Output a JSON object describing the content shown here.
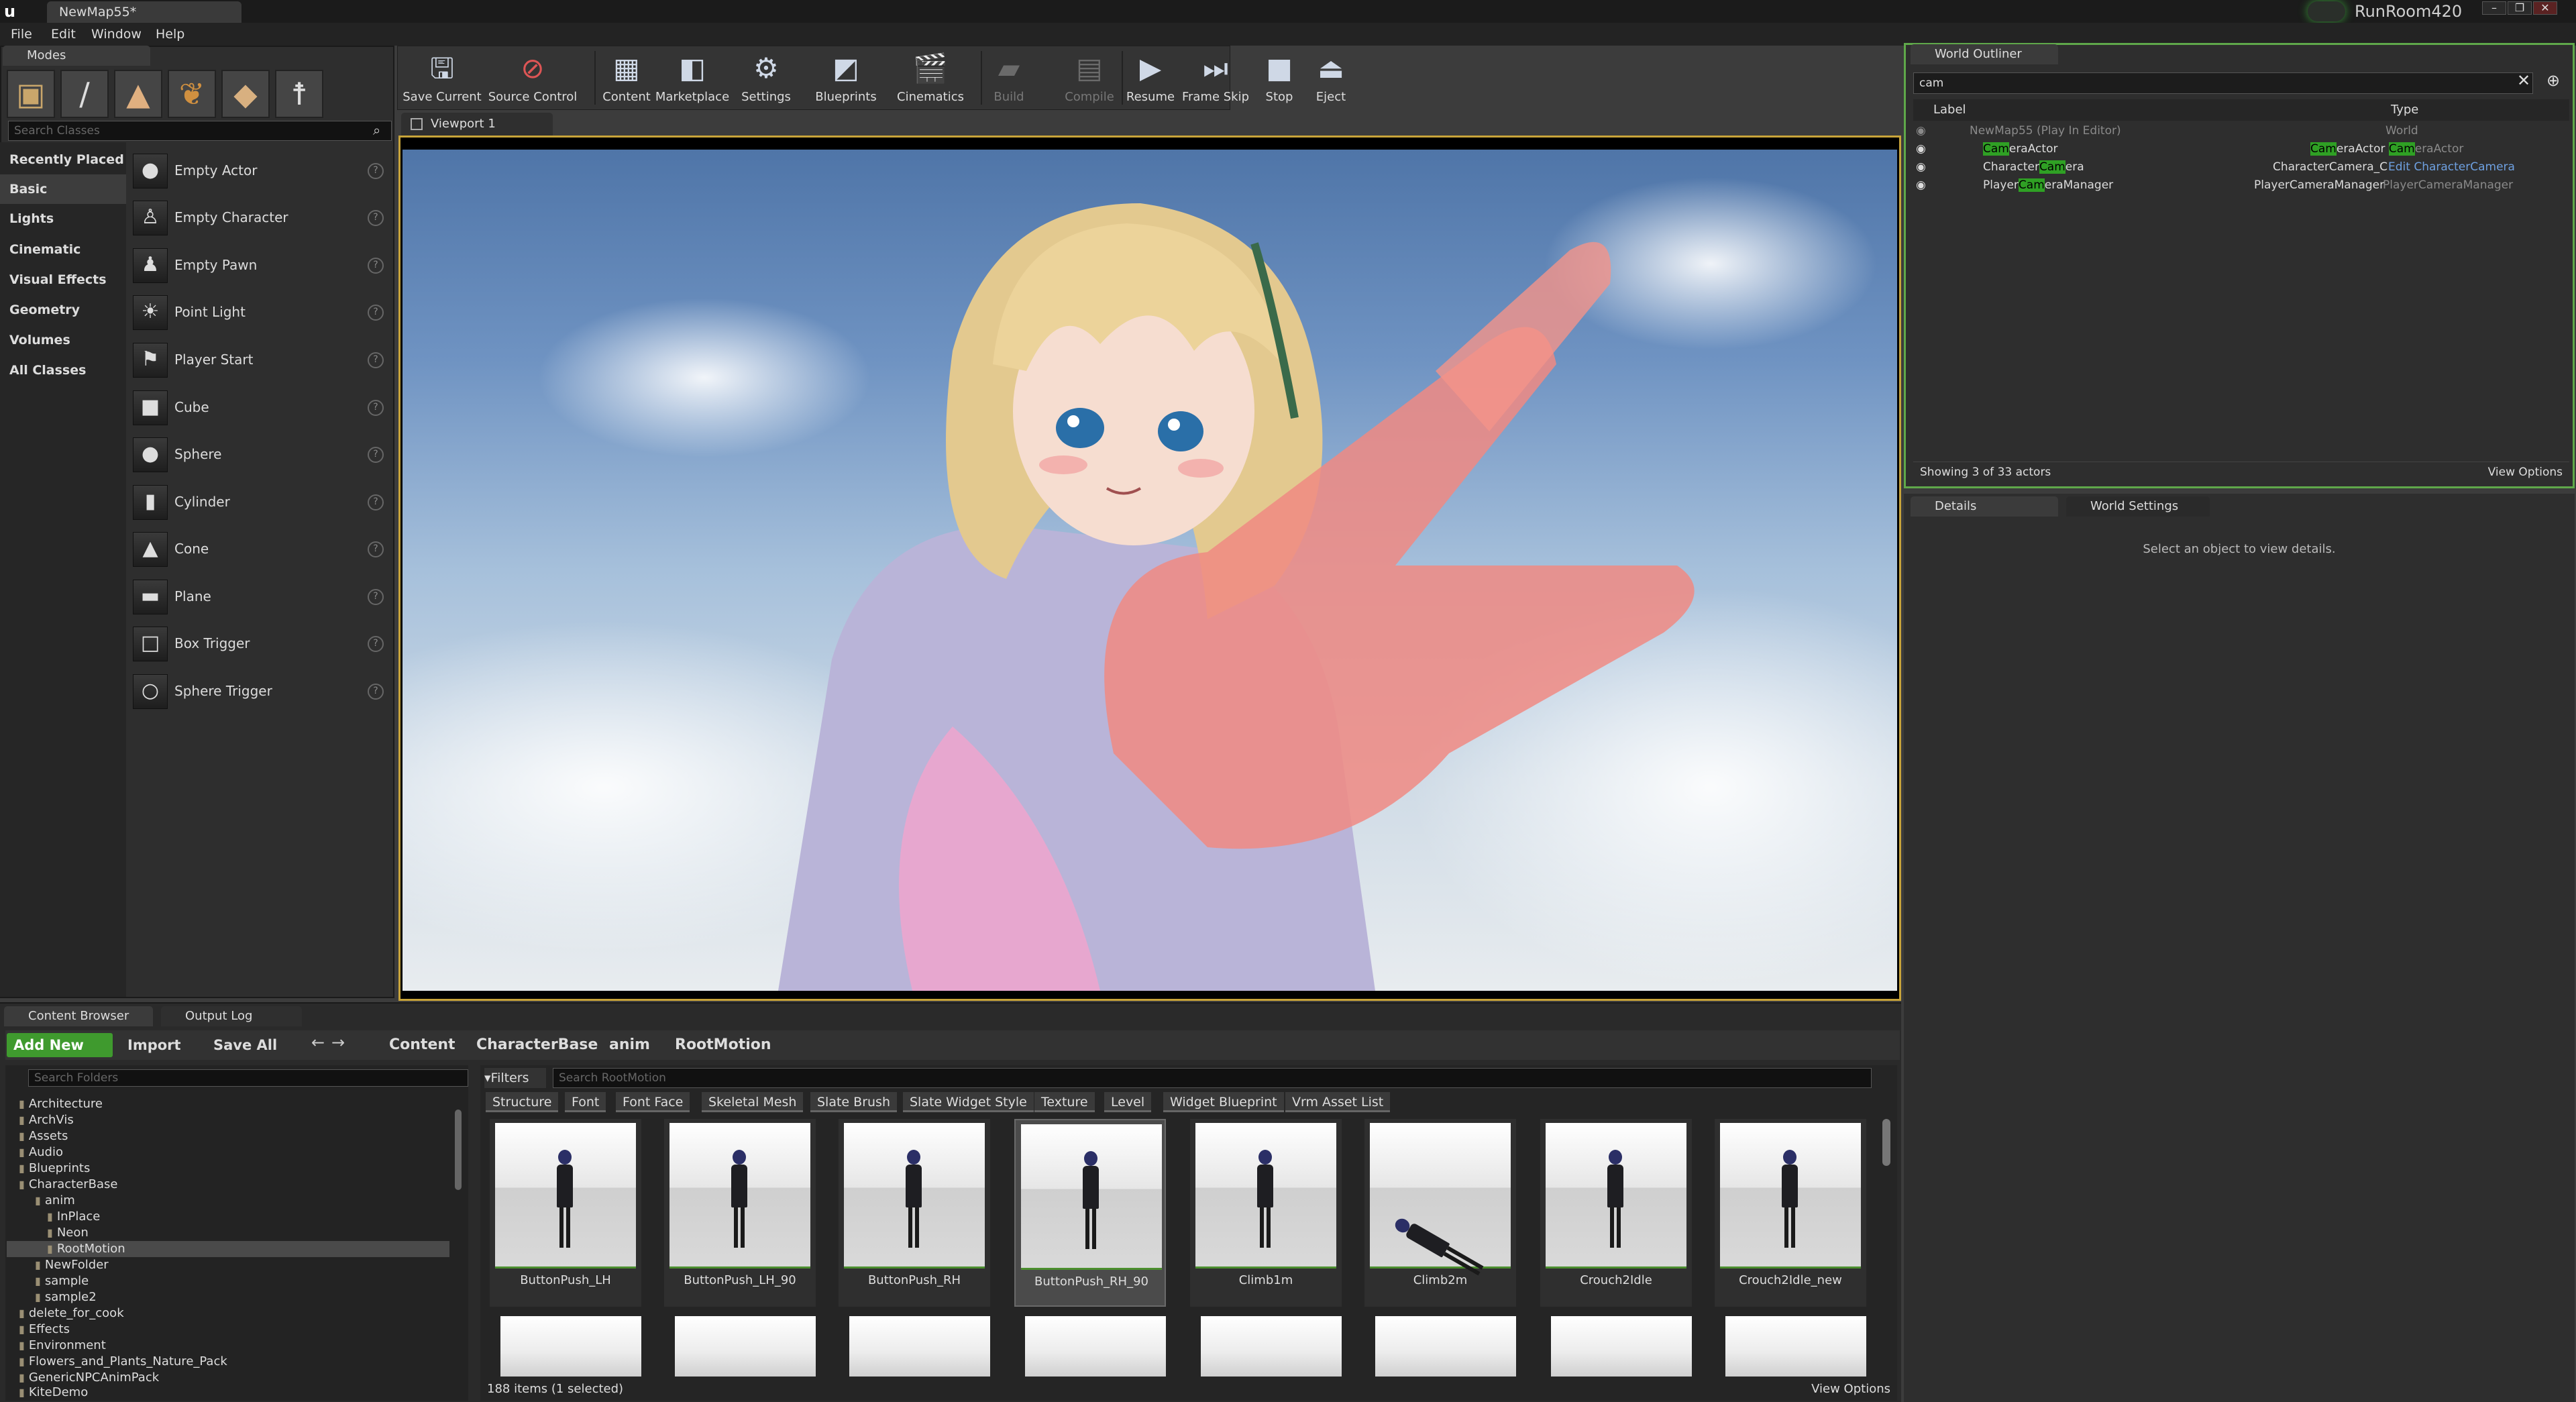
{
  "window": {
    "map_tab": "NewMap55*",
    "project": "RunRoom420",
    "controls": [
      "–",
      "❐",
      "✕"
    ]
  },
  "menu": [
    "File",
    "Edit",
    "Window",
    "Help"
  ],
  "modes": {
    "tab": "Modes",
    "search_placeholder": "Search Classes",
    "categories": [
      "Recently Placed",
      "Basic",
      "Lights",
      "Cinematic",
      "Visual Effects",
      "Geometry",
      "Volumes",
      "All Classes"
    ],
    "items": [
      "Empty Actor",
      "Empty Character",
      "Empty Pawn",
      "Point Light",
      "Player Start",
      "Cube",
      "Sphere",
      "Cylinder",
      "Cone",
      "Plane",
      "Box Trigger",
      "Sphere Trigger"
    ]
  },
  "toolbar": {
    "save_current": "Save Current",
    "source_control": "Source Control",
    "content": "Content",
    "marketplace": "Marketplace",
    "settings": "Settings",
    "blueprints": "Blueprints",
    "cinematics": "Cinematics",
    "build": "Build",
    "compile": "Compile",
    "resume": "Resume",
    "frame_skip": "Frame Skip",
    "stop": "Stop",
    "eject": "Eject"
  },
  "viewport": {
    "tab": "Viewport 1"
  },
  "outliner": {
    "tab": "World Outliner",
    "search_value": "cam",
    "col_label": "Label",
    "col_type": "Type",
    "rows": [
      {
        "label": "NewMap55 (Play In Editor)",
        "type": "World"
      },
      {
        "label_pre": "",
        "label_hl": "Cam",
        "label_post": "eraActor",
        "type_pre": "",
        "type_hl": "Cam",
        "type_post": "eraActor",
        "type2_hl": "Cam",
        "type2_post": "eraActor"
      },
      {
        "label_pre": "Character",
        "label_hl": "Cam",
        "label_post": "era",
        "type": "CharacterCamera_C",
        "edit": "Edit CharacterCamera"
      },
      {
        "label_pre": "Player",
        "label_hl": "Cam",
        "label_post": "eraManager",
        "type_a": "PlayerCameraManager",
        "type_b": "PlayerCameraManager"
      }
    ],
    "footer": "Showing 3 of 33 actors",
    "view_options": "View Options"
  },
  "details": {
    "tab": "Details",
    "world_settings_tab": "World Settings",
    "empty_msg": "Select an object to view details."
  },
  "content_browser": {
    "tab": "Content Browser",
    "output_log_tab": "Output Log",
    "add_new": "Add New",
    "import": "Import",
    "save_all": "Save All",
    "breadcrumb": [
      "Content",
      "CharacterBase",
      "anim",
      "RootMotion"
    ],
    "search_folders_placeholder": "Search Folders",
    "filters_label": "Filters",
    "search_assets_placeholder": "Search RootMotion",
    "filters": [
      "Structure",
      "Font",
      "Font Face",
      "Skeletal Mesh",
      "Slate Brush",
      "Slate Widget Style",
      "Texture",
      "Level",
      "Widget Blueprint",
      "Vrm Asset List"
    ],
    "folders": [
      "Architecture",
      "ArchVis",
      "Assets",
      "Audio",
      "Blueprints",
      "CharacterBase",
      "anim",
      "InPlace",
      "Neon",
      "RootMotion",
      "NewFolder",
      "sample",
      "sample2",
      "delete_for_cook",
      "Effects",
      "Environment",
      "Flowers_and_Plants_Nature_Pack",
      "GenericNPCAnimPack",
      "KiteDemo"
    ],
    "assets": [
      "ButtonPush_LH",
      "ButtonPush_LH_90",
      "ButtonPush_RH",
      "ButtonPush_RH_90",
      "Climb1m",
      "Climb2m",
      "Crouch2Idle",
      "Crouch2Idle_new"
    ],
    "status": "188 items (1 selected)",
    "view_options": "View Options"
  }
}
